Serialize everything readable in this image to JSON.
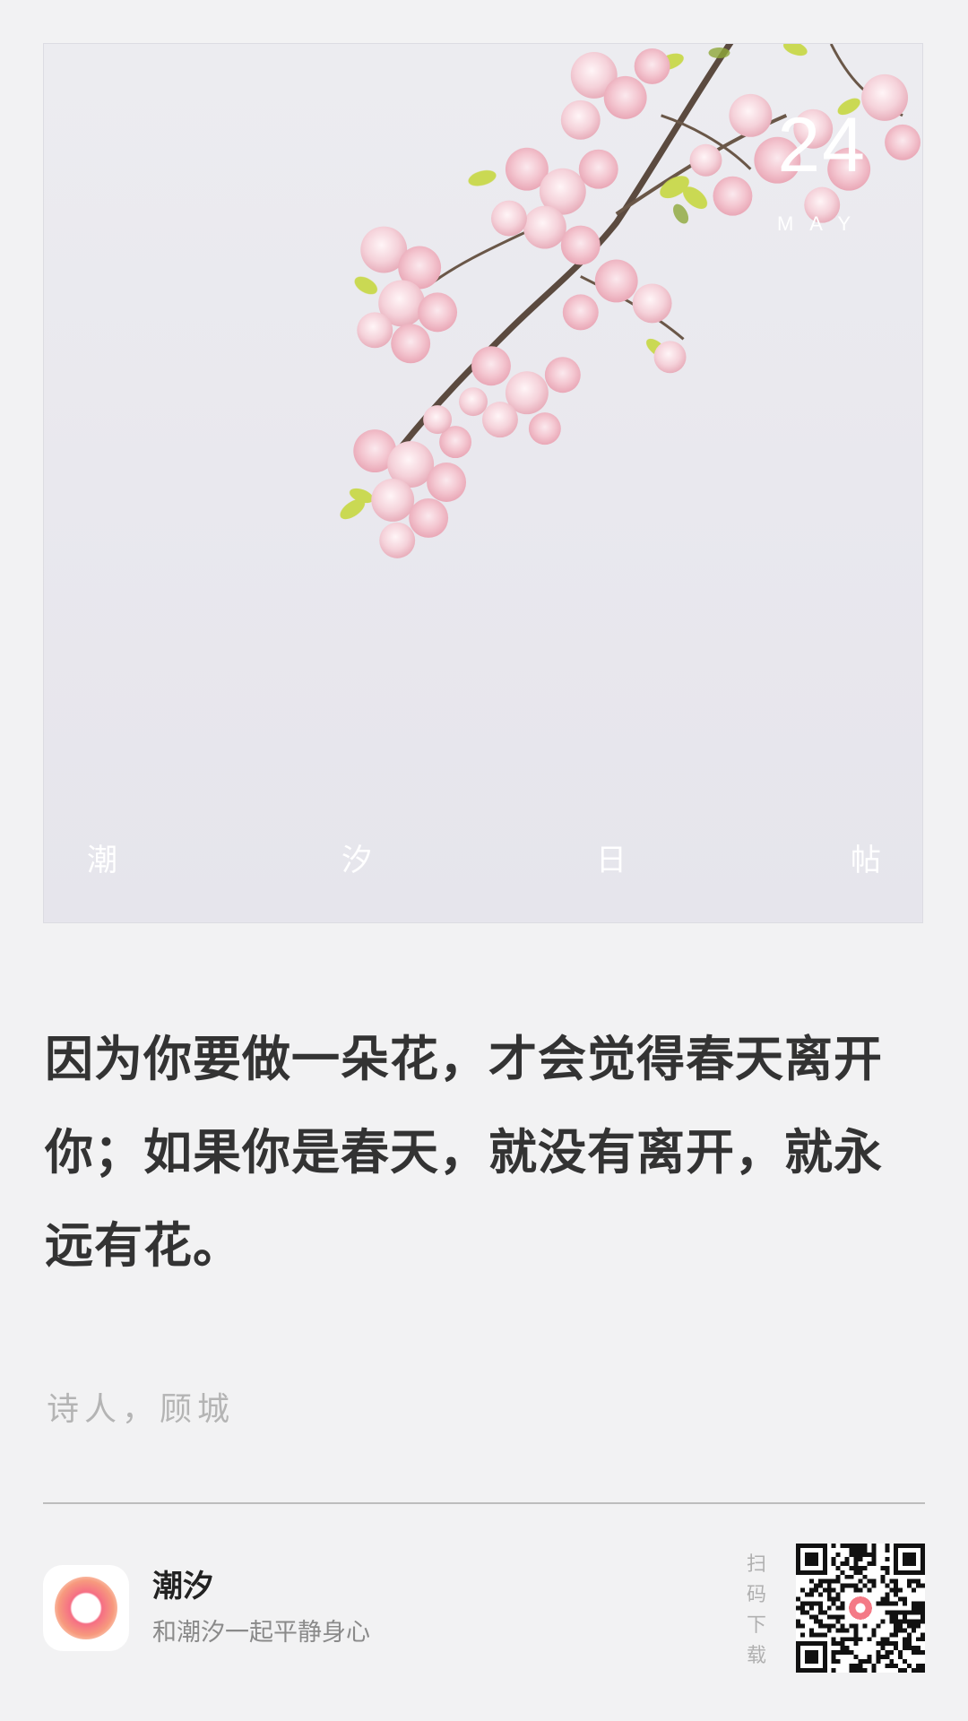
{
  "card": {
    "date_day": "24",
    "date_month": "MAY",
    "brand_chars": [
      "潮",
      "汐",
      "日",
      "帖"
    ],
    "image": "cherry-blossom-branch"
  },
  "quote": {
    "text": "因为你要做一朵花，才会觉得春天离开你；如果你是春天，就没有离开，就永远有花。",
    "author": "诗人，顾城"
  },
  "footer": {
    "app_icon": "tide-ring-icon",
    "app_name": "潮汐",
    "slogan": "和潮汐一起平静身心",
    "scan_chars": [
      "扫",
      "码",
      "下",
      "载"
    ],
    "qr_icon": "qr-code-icon"
  },
  "colors": {
    "background": "#f2f2f3",
    "quote_text": "#333333",
    "muted_text": "#b4b4b4",
    "blossom_pink": "#f3c2cc",
    "leaf_green": "#c9d84a",
    "brand_gradient": [
      "#f56e84",
      "#f79a7e"
    ]
  }
}
